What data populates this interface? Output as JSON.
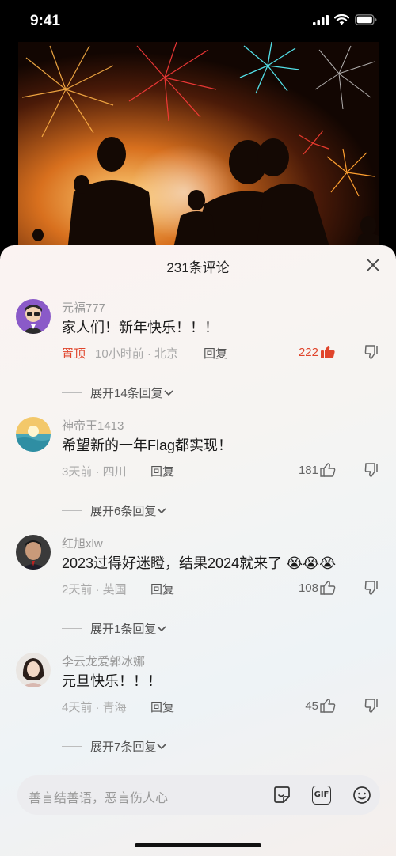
{
  "status": {
    "time": "9:41"
  },
  "sheet": {
    "title": "231条评论",
    "close_icon": "close-icon"
  },
  "comments": [
    {
      "username": "元福777",
      "content": "家人们！新年快乐！！！",
      "pin_label": "置顶",
      "time_location": "10小时前 · 北京",
      "reply_label": "回复",
      "likes": "222",
      "liked": true,
      "expand_label": "展开14条回复",
      "avatar_icon": "avatar-cartoon-man"
    },
    {
      "username": "神帝王1413",
      "content": "希望新的一年Flag都实现！",
      "time_location": "3天前 · 四川",
      "reply_label": "回复",
      "likes": "181",
      "liked": false,
      "expand_label": "展开6条回复",
      "avatar_icon": "avatar-sunset-beach"
    },
    {
      "username": "红旭xlw",
      "content": "2023过得好迷瞪，结果2024就来了",
      "emoji": "😭😭😭",
      "time_location": "2天前 · 英国",
      "reply_label": "回复",
      "likes": "108",
      "liked": false,
      "expand_label": "展开1条回复",
      "avatar_icon": "avatar-man-photo"
    },
    {
      "username": "李云龙爱郭冰娜",
      "content": "元旦快乐！！！",
      "time_location": "4天前 · 青海",
      "reply_label": "回复",
      "likes": "45",
      "liked": false,
      "expand_label": "展开7条回复",
      "avatar_icon": "avatar-woman-photo"
    }
  ],
  "input": {
    "placeholder": "善言结善语，恶言伤人心",
    "gif_label": "GIF",
    "icons": [
      "sticker-icon",
      "gif-icon",
      "emoji-icon"
    ]
  },
  "colors": {
    "accent": "#e0442b",
    "secondary_text": "#a8a8a8"
  }
}
